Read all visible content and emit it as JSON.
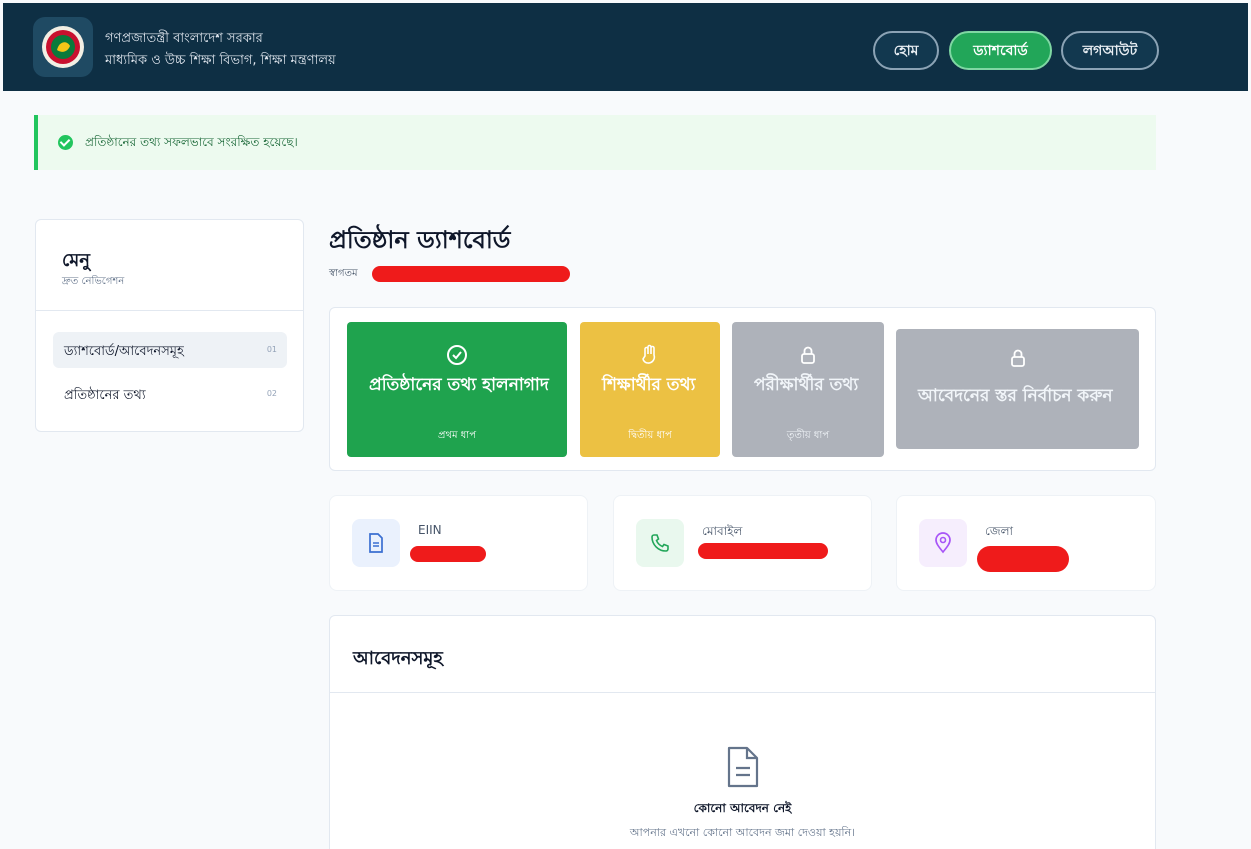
{
  "header": {
    "line1": "গণপ্রজাতন্ত্রী বাংলাদেশ সরকার",
    "line2": "মাধ্যমিক ও উচ্চ শিক্ষা বিভাগ, শিক্ষা মন্ত্রণালয়",
    "nav": {
      "home": "হোম",
      "dashboard": "ড্যাশবোর্ড",
      "logout": "লগআউট"
    }
  },
  "alert": {
    "message": "প্রতিষ্ঠানের তথ্য সফলভাবে সংরক্ষিত হয়েছে।"
  },
  "sidebar": {
    "title": "মেনু",
    "subtitle": "দ্রুত নেভিগেশন",
    "items": [
      {
        "label": "ড্যাশবোর্ড/আবেদনসমূহ",
        "num": "01"
      },
      {
        "label": "প্রতিষ্ঠানের তথ্য",
        "num": "02"
      }
    ]
  },
  "main": {
    "title": "প্রতিষ্ঠান ড্যাশবোর্ড",
    "welcome": "স্বাগতম"
  },
  "steps": [
    {
      "title": "প্রতিষ্ঠানের তথ্য হালনাগাদ",
      "subtitle": "প্রথম ধাপ",
      "icon": "check-circle-icon",
      "color": "#1fa34e"
    },
    {
      "title": "শিক্ষার্থীর তথ্য",
      "subtitle": "দ্বিতীয় ধাপ",
      "icon": "hand-icon",
      "color": "#ecc143"
    },
    {
      "title": "পরীক্ষার্থীর তথ্য",
      "subtitle": "তৃতীয় ধাপ",
      "icon": "lock-icon",
      "color": "#aeb2ba"
    },
    {
      "title": "আবেদনের স্তর নির্বাচন করুন",
      "icon": "lock-icon",
      "color": "#aeb2ba"
    }
  ],
  "info": {
    "eiin_label": "EIIN",
    "mobile_label": "মোবাইল",
    "district_label": "জেলা"
  },
  "applications": {
    "title": "আবেদনসমূহ",
    "empty_title": "কোনো আবেদন নেই",
    "empty_subtitle": "আপনার এখনো কোনো আবেদন জমা দেওয়া হয়নি।"
  }
}
